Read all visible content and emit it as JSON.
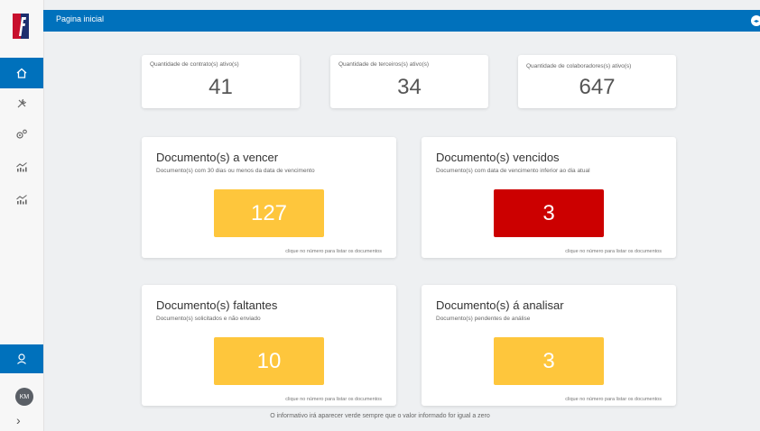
{
  "topbar": {
    "title": "Pagina inicial"
  },
  "sidebar": {
    "avatar_initials": "KM",
    "expand": "›"
  },
  "stats": [
    {
      "label": "Quantidade de contrato(s) ativo(s)",
      "value": "41"
    },
    {
      "label": "Quantidade de terceiros(s) ativo(s)",
      "value": "34"
    },
    {
      "label": "Quantidade de colaboradores(s) ativo(s)",
      "value": "647"
    }
  ],
  "docs": [
    {
      "title": "Documento(s) a vencer",
      "subtitle": "Documento(s) com 30 dias ou menos da data de vencimento",
      "value": "127",
      "hint": "clique no número para listar os documentos",
      "color": "#fec63c"
    },
    {
      "title": "Documento(s) vencidos",
      "subtitle": "Documento(s) com data de vencimento inferior ao dia atual",
      "value": "3",
      "hint": "clique no número para listar os documentos",
      "color": "#cc0000"
    },
    {
      "title": "Documento(s) faltantes",
      "subtitle": "Documento(s) solicitados e não enviado",
      "value": "10",
      "hint": "clique no número para listar os documentos",
      "color": "#fec63c"
    },
    {
      "title": "Documento(s) á analisar",
      "subtitle": "Documento(s) pendentes de análise",
      "value": "3",
      "hint": "clique no número para listar os documentos",
      "color": "#fec63c"
    }
  ],
  "footer": "O informativo irá aparecer verde sempre que o valor informado for igual a zero"
}
